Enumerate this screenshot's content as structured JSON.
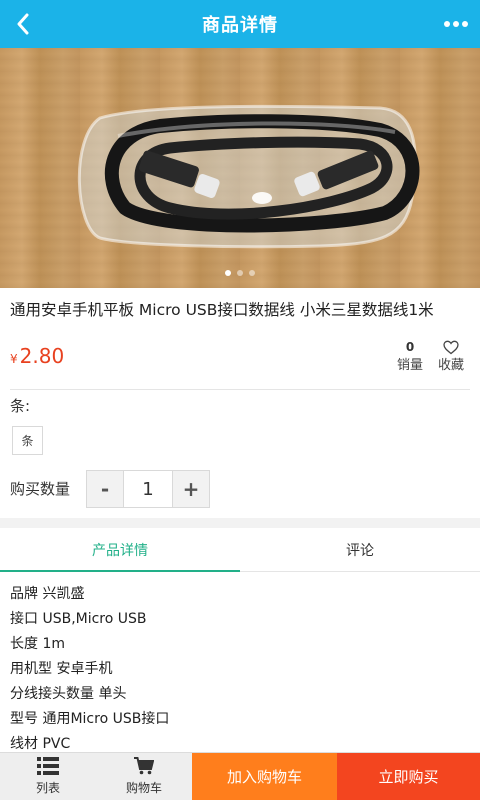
{
  "header": {
    "title": "商品详情",
    "back_icon": "chevron-left-icon",
    "menu_icon": "more-dots-icon",
    "color": "#1bb3e8"
  },
  "gallery": {
    "image_count": 3,
    "active_index": 0,
    "image_subject": "black braided USB cable in clear package on wooden table"
  },
  "product": {
    "title": "通用安卓手机平板 Micro USB接口数据线 小米三星数据线1米",
    "currency": "¥",
    "price": "2.80",
    "sales_count": "0",
    "sales_label": "销量",
    "favorite_label": "收藏"
  },
  "spec": {
    "label": "条:",
    "options": [
      "条"
    ],
    "selected": "条"
  },
  "quantity": {
    "label": "购买数量",
    "minus": "-",
    "value": "1",
    "plus": "+"
  },
  "tabs": [
    {
      "label": "产品详情",
      "active": true
    },
    {
      "label": "评论",
      "active": false
    }
  ],
  "details": [
    "品牌 兴凯盛",
    "接口 USB,Micro USB",
    "长度 1m",
    "用机型 安卓手机",
    "分线接头数量 单头",
    "型号 通用Micro USB接口",
    "线材 PVC"
  ],
  "bottom_bar": {
    "list_label": "列表",
    "cart_label": "购物车",
    "add_to_cart": "加入购物车",
    "buy_now": "立即购买",
    "add_color": "#ff7e1c",
    "buy_color": "#f3451f"
  },
  "colors": {
    "accent_green": "#22b089",
    "price_red": "#e8411f"
  }
}
